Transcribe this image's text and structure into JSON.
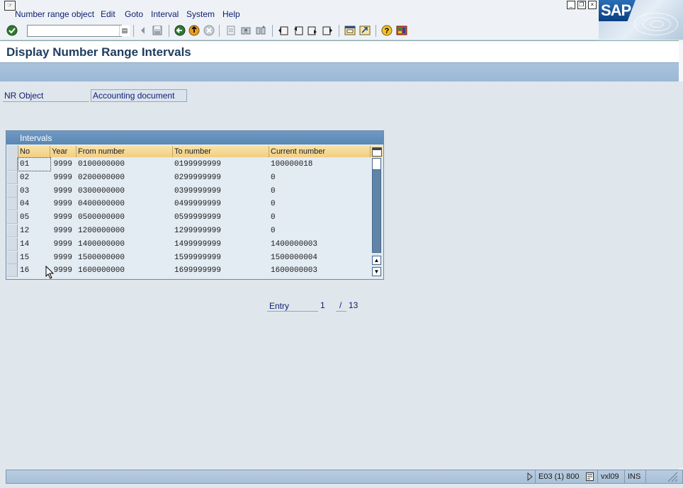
{
  "menubar": {
    "items": [
      {
        "label": "Number range object"
      },
      {
        "label": "Edit"
      },
      {
        "label": "Goto"
      },
      {
        "label": "Interval"
      },
      {
        "label": "System"
      },
      {
        "label": "Help"
      }
    ]
  },
  "logo": {
    "text": "SAP"
  },
  "toolbar": {
    "command_field_value": "",
    "buttons": [
      "enter-icon",
      "save-icon",
      "back-icon",
      "exit-icon",
      "cancel-icon",
      "print-icon",
      "find-icon",
      "find-next-icon",
      "first-page-icon",
      "previous-page-icon",
      "next-page-icon",
      "last-page-icon",
      "create-session-icon",
      "shortcut-icon",
      "help-icon",
      "customize-layout-icon"
    ]
  },
  "page": {
    "title": "Display Number Range Intervals"
  },
  "nr_object": {
    "label": "NR Object",
    "value": "Accounting document"
  },
  "table": {
    "title": "Intervals",
    "columns": [
      "No",
      "Year",
      "From number",
      "To number",
      "Current number"
    ],
    "rows": [
      {
        "no": "01",
        "year": "9999",
        "from": "0100000000",
        "to": "0199999999",
        "current": "100000018"
      },
      {
        "no": "02",
        "year": "9999",
        "from": "0200000000",
        "to": "0299999999",
        "current": "0"
      },
      {
        "no": "03",
        "year": "9999",
        "from": "0300000000",
        "to": "0399999999",
        "current": "0"
      },
      {
        "no": "04",
        "year": "9999",
        "from": "0400000000",
        "to": "0499999999",
        "current": "0"
      },
      {
        "no": "05",
        "year": "9999",
        "from": "0500000000",
        "to": "0599999999",
        "current": "0"
      },
      {
        "no": "12",
        "year": "9999",
        "from": "1200000000",
        "to": "1299999999",
        "current": "0"
      },
      {
        "no": "14",
        "year": "9999",
        "from": "1400000000",
        "to": "1499999999",
        "current": "1400000003"
      },
      {
        "no": "15",
        "year": "9999",
        "from": "1500000000",
        "to": "1599999999",
        "current": "1500000004"
      },
      {
        "no": "16",
        "year": "9999",
        "from": "1600000000",
        "to": "1699999999",
        "current": "1600000003"
      }
    ]
  },
  "entry": {
    "label": "Entry",
    "current": "1",
    "separator": "/",
    "total": "13"
  },
  "statusbar": {
    "system": "E03 (1) 800",
    "server": "vxl09",
    "mode": "INS"
  },
  "colors": {
    "title_text": "#1e3c5f",
    "header_cell": "#f1cf82",
    "table_title": "#5a87b3",
    "app_toolbar": "#9ab8d6"
  }
}
